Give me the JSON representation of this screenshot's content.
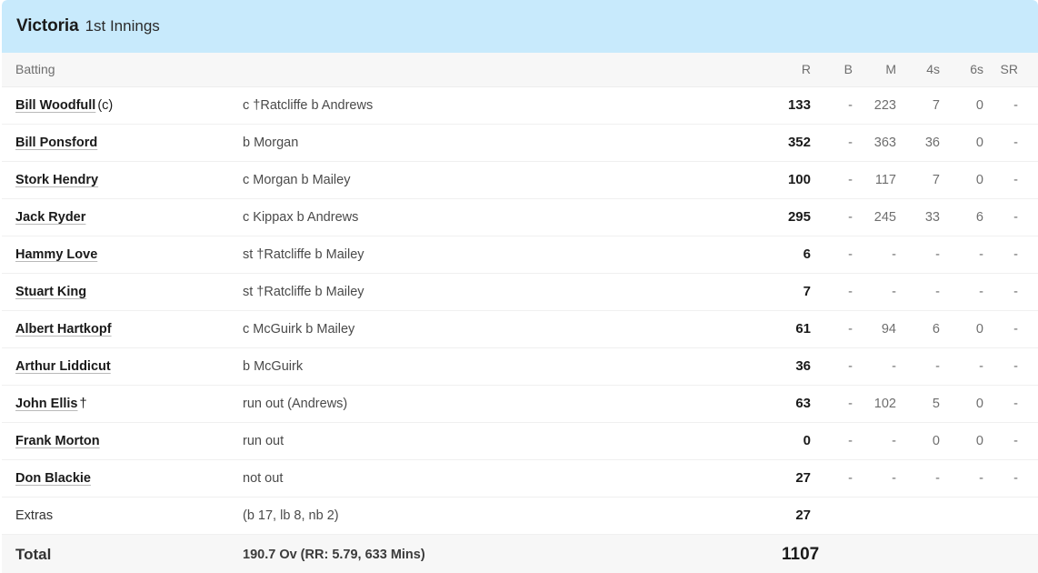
{
  "innings": {
    "team": "Victoria",
    "label": "1st Innings"
  },
  "table": {
    "headers": {
      "batting": "Batting",
      "runs": "R",
      "balls": "B",
      "minutes": "M",
      "fours": "4s",
      "sixes": "6s",
      "strike_rate": "SR"
    },
    "rows": [
      {
        "name": "Bill Woodfull",
        "suffix": "(c)",
        "dismissal": "c †Ratcliffe b Andrews",
        "r": "133",
        "b": "-",
        "m": "223",
        "fours": "7",
        "sixes": "0",
        "sr": "-"
      },
      {
        "name": "Bill Ponsford",
        "suffix": "",
        "dismissal": "b Morgan",
        "r": "352",
        "b": "-",
        "m": "363",
        "fours": "36",
        "sixes": "0",
        "sr": "-"
      },
      {
        "name": "Stork Hendry",
        "suffix": "",
        "dismissal": "c Morgan b Mailey",
        "r": "100",
        "b": "-",
        "m": "117",
        "fours": "7",
        "sixes": "0",
        "sr": "-"
      },
      {
        "name": "Jack Ryder",
        "suffix": "",
        "dismissal": "c Kippax b Andrews",
        "r": "295",
        "b": "-",
        "m": "245",
        "fours": "33",
        "sixes": "6",
        "sr": "-"
      },
      {
        "name": "Hammy Love",
        "suffix": "",
        "dismissal": "st †Ratcliffe b Mailey",
        "r": "6",
        "b": "-",
        "m": "-",
        "fours": "-",
        "sixes": "-",
        "sr": "-"
      },
      {
        "name": "Stuart King",
        "suffix": "",
        "dismissal": "st †Ratcliffe b Mailey",
        "r": "7",
        "b": "-",
        "m": "-",
        "fours": "-",
        "sixes": "-",
        "sr": "-"
      },
      {
        "name": "Albert Hartkopf",
        "suffix": "",
        "dismissal": "c McGuirk b Mailey",
        "r": "61",
        "b": "-",
        "m": "94",
        "fours": "6",
        "sixes": "0",
        "sr": "-"
      },
      {
        "name": "Arthur Liddicut",
        "suffix": "",
        "dismissal": "b McGuirk",
        "r": "36",
        "b": "-",
        "m": "-",
        "fours": "-",
        "sixes": "-",
        "sr": "-"
      },
      {
        "name": "John Ellis",
        "suffix": "†",
        "dismissal": "run out (Andrews)",
        "r": "63",
        "b": "-",
        "m": "102",
        "fours": "5",
        "sixes": "0",
        "sr": "-"
      },
      {
        "name": "Frank Morton",
        "suffix": "",
        "dismissal": "run out",
        "r": "0",
        "b": "-",
        "m": "-",
        "fours": "0",
        "sixes": "0",
        "sr": "-"
      },
      {
        "name": "Don Blackie",
        "suffix": "",
        "dismissal": "not out",
        "r": "27",
        "b": "-",
        "m": "-",
        "fours": "-",
        "sixes": "-",
        "sr": "-"
      }
    ],
    "extras": {
      "label": "Extras",
      "detail": "(b 17, lb 8, nb 2)",
      "r": "27"
    },
    "total": {
      "label": "Total",
      "detail": "190.7 Ov (RR: 5.79, 633 Mins)",
      "runs": "1107"
    }
  },
  "colors": {
    "innings_header_bg": "#c8eafc",
    "table_header_bg": "#f7f7f7",
    "total_row_bg": "#f7f7f7",
    "row_divider": "#f0f0f0"
  }
}
